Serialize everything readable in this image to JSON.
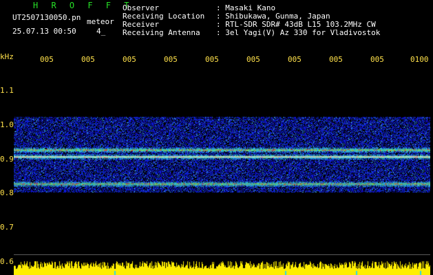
{
  "app": {
    "title": "H R O F F T",
    "filename": "UT2507130050.pn",
    "meteor_label": "meteor",
    "datetime": "25.07.13 00:50",
    "count": "4_"
  },
  "station": {
    "labels": [
      "Observer",
      "Receiving Location",
      "Receiver",
      "Receiving Antenna"
    ],
    "values": [
      ": Masaki Kano",
      ": Shibukawa, Gunma, Japan",
      ": RTL-SDR SDR# 43dB L15 103.2MHz CW",
      ": 3el Yagi(V) Az 330 for Vladivostok"
    ]
  },
  "axes": {
    "y_unit": "kHz",
    "y_ticks": [
      "1.1",
      "1.0",
      "0.9",
      "0.8",
      "0.7",
      "0.6"
    ],
    "x_ticks": [
      "005",
      "005",
      "005",
      "005",
      "005",
      "005",
      "005",
      "005",
      "005",
      "0100"
    ]
  },
  "waterfall": {
    "band_edges_khz": [
      0.8,
      1.02
    ],
    "strong_lines_khz": [
      0.825,
      0.905,
      0.925
    ],
    "colors": {
      "bg": "#000000",
      "noise": "#1a2bd6",
      "signal": "#31d8e6",
      "hot": "#ff3a2a",
      "amplitude": "#ffee00"
    }
  }
}
